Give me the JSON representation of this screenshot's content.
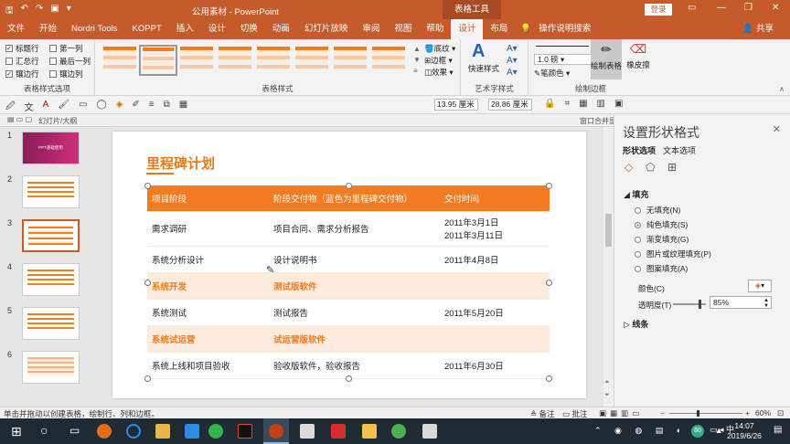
{
  "window": {
    "title": "公用素材  -  PowerPoint",
    "context_tab": "表格工具",
    "login": "登录",
    "min": "—",
    "max": "❐",
    "close": "✕"
  },
  "tabs": [
    "文件",
    "开始",
    "Nordri Tools",
    "KOPPT",
    "插入",
    "设计",
    "切换",
    "动画",
    "幻灯片放映",
    "审阅",
    "视图",
    "帮助",
    "设计",
    "布局"
  ],
  "active_tab_index": 12,
  "tell_me": "操作说明搜索",
  "share": "共享",
  "ribbon": {
    "style_options": {
      "label": "表格样式选项",
      "items": [
        {
          "label": "标题行",
          "checked": true
        },
        {
          "label": "第一列",
          "checked": false
        },
        {
          "label": "汇总行",
          "checked": false
        },
        {
          "label": "最后一列",
          "checked": false
        },
        {
          "label": "镶边行",
          "checked": true
        },
        {
          "label": "镶边列",
          "checked": false
        }
      ]
    },
    "table_styles": {
      "label": "表格样式",
      "shading": "底纹",
      "border": "边框",
      "effect": "效果"
    },
    "wordart": {
      "label": "艺术字样式",
      "quick": "快速样式"
    },
    "draw": {
      "label": "绘制边框",
      "pen_weight": "1.0 磅",
      "pen_color": "笔颜色",
      "draw_table": "绘制表格",
      "eraser": "橡皮擦"
    }
  },
  "toolbar2": {
    "height_value": "13.95 厘米",
    "width_value": "28.86 厘米"
  },
  "toolbar3": {
    "left": "幻灯片/大纲",
    "right": "窗口合并显示"
  },
  "thumbs": [
    {
      "n": "1",
      "caption": "PPT基础使用"
    },
    {
      "n": "2",
      "caption": ""
    },
    {
      "n": "3",
      "caption": ""
    },
    {
      "n": "4",
      "caption": ""
    },
    {
      "n": "5",
      "caption": ""
    },
    {
      "n": "6",
      "caption": ""
    }
  ],
  "slide": {
    "title": "里程碑计划",
    "table": {
      "headers": [
        "项目阶段",
        "阶段交付物（蓝色为里程碑交付物）",
        "交付时间"
      ],
      "rows": [
        {
          "stage": "需求调研",
          "deliverable": "项目合同、需求分析报告",
          "time": "2011年3月1日",
          "time2": "2011年3月11日",
          "hl": false
        },
        {
          "stage": "系统分析设计",
          "deliverable": "设计说明书",
          "time": "2011年4月8日",
          "time2": "",
          "hl": false
        },
        {
          "stage": "系统开发",
          "deliverable": "测试版软件",
          "time": "",
          "time2": "",
          "hl": true
        },
        {
          "stage": "系统测试",
          "deliverable": "测试报告",
          "time": "2011年5月20日",
          "time2": "",
          "hl": false
        },
        {
          "stage": "系统试运营",
          "deliverable": "试运营版软件",
          "time": "",
          "time2": "",
          "hl": true
        },
        {
          "stage": "系统上线和项目验收",
          "deliverable": "验收版软件，验收报告",
          "time": "2011年6月30日",
          "time2": "",
          "hl": false
        }
      ]
    }
  },
  "pane": {
    "title": "设置形状格式",
    "tab_shape": "形状选项",
    "tab_text": "文本选项",
    "section_fill": "填充",
    "fill_options": [
      {
        "label": "无填充(N)",
        "selected": false
      },
      {
        "label": "纯色填充(S)",
        "selected": true
      },
      {
        "label": "渐变填充(G)",
        "selected": false
      },
      {
        "label": "图片或纹理填充(P)",
        "selected": false
      },
      {
        "label": "图案填充(A)",
        "selected": false
      }
    ],
    "color_label": "颜色(C)",
    "transparency_label": "透明度(T)",
    "transparency_value": "85%",
    "transparency": 0.85,
    "section_line": "线条"
  },
  "status": {
    "left": "单击并拖动以创建表格，绘制行、列和边框。",
    "notes": "备注",
    "comments": "批注",
    "zoom": "60%"
  },
  "taskbar": {
    "time": "14:07",
    "date": "2019/6/26",
    "badge": "60"
  },
  "colors": {
    "accent": "#c55a2b",
    "table_header": "#f47c20",
    "table_highlight": "#fdebdc"
  }
}
